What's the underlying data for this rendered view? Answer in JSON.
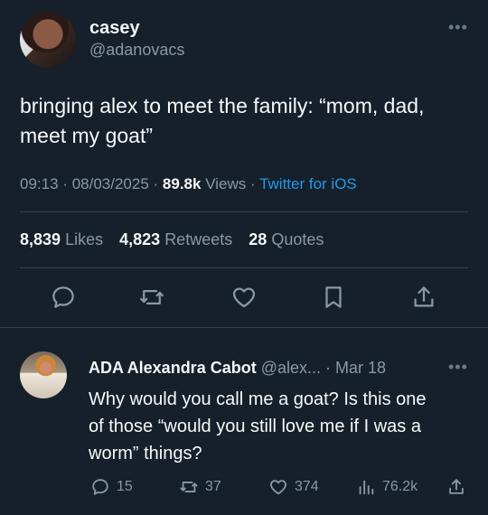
{
  "tweet": {
    "display_name": "casey",
    "handle": "@adanovacs",
    "text_line1": "bringing alex to meet the family: “mom, dad,",
    "text_line2": "meet my goat”",
    "time": "09:13",
    "date": "08/03/2025",
    "views_count": "89.8k",
    "views_label": "Views",
    "source": "Twitter for iOS",
    "separator": "·"
  },
  "stats": {
    "likes_count": "8,839",
    "likes_label": "Likes",
    "retweets_count": "4,823",
    "retweets_label": "Retweets",
    "quotes_count": "28",
    "quotes_label": "Quotes"
  },
  "actions": [
    "reply-icon",
    "retweet-icon",
    "like-icon",
    "bookmark-icon",
    "share-icon"
  ],
  "reply": {
    "display_name": "ADA Alexandra Cabot",
    "handle": "@alex...",
    "separator": "·",
    "date": "Mar 18",
    "text_line1": "Why would you call me a goat? Is this one",
    "text_line2": "of those “would you still love me if I was a",
    "text_line3": "worm” things?",
    "replies": "15",
    "retweets": "37",
    "likes": "374",
    "views": "76.2k"
  },
  "colors": {
    "background": "#15202b",
    "text": "#f7f9f9",
    "muted": "#8b98a5",
    "accent": "#1d9bf0",
    "divider": "#38444d"
  }
}
